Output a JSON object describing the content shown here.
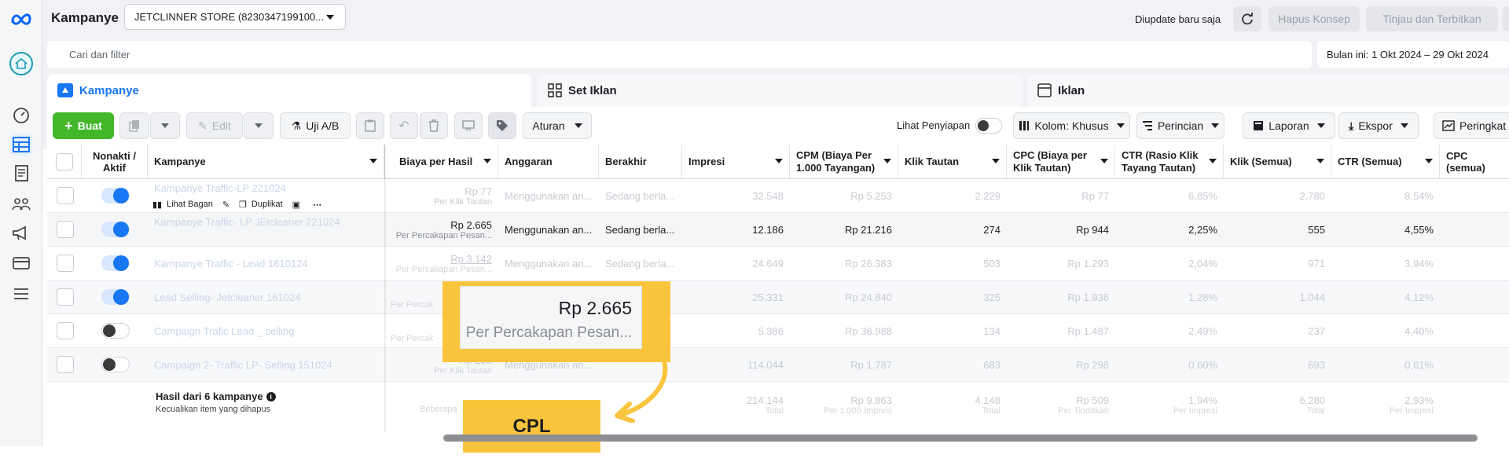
{
  "header": {
    "title": "Kampanye",
    "account_select": "JETCLINNER STORE (8230347199100...",
    "update_status": "Diupdate baru saja",
    "discard_label": "Hapus Konsep",
    "publish_label": "Tinjau dan Terbitkan",
    "more_label": "..."
  },
  "search": {
    "placeholder": "Cari dan filter",
    "date_range": "Bulan ini: 1 Okt 2024 – 29 Okt 2024"
  },
  "tabs": {
    "campaigns": "Kampanye",
    "adsets": "Set Iklan",
    "ads": "Iklan"
  },
  "toolbar": {
    "create": "Buat",
    "edit": "Edit",
    "ab_test": "Uji A/B",
    "rules": "Aturan",
    "preview_label": "Lihat Penyiapan",
    "columns": "Kolom: Khusus",
    "breakdown": "Perincian",
    "reports": "Laporan",
    "export": "Ekspor",
    "summary": "Peringkat"
  },
  "columns": {
    "toggle": "Nonakti / Aktif",
    "campaign": "Kampanye",
    "cost_per_result": "Biaya per Hasil",
    "budget": "Anggaran",
    "ends": "Berakhir",
    "impressions": "Impresi",
    "cpm": "CPM (Biaya Per 1.000 Tayangan)",
    "link_clicks": "Klik Tautan",
    "cpc_link": "CPC (Biaya per Klik Tautan)",
    "ctr_link": "CTR (Rasio Klik Tayang Tautan)",
    "clicks_all": "Klik (Semua)",
    "ctr_all": "CTR (Semua)",
    "cpc_all": "CPC (semua)"
  },
  "row_actions": {
    "view_chart": "Lihat Bagan",
    "duplicate": "Duplikat"
  },
  "rows": [
    {
      "name": "Kampanye Traffic-LP 221024",
      "active": true,
      "cpr": "Rp 77",
      "cpr_sub": "Per Klik Tautan",
      "budget": "Menggunakan an...",
      "ends": "Sedang berla...",
      "impressions": "32.548",
      "cpm": "Rp 5.253",
      "link_clicks": "2.229",
      "cpc": "Rp 77",
      "ctr_link": "6,85%",
      "clicks_all": "2.780",
      "ctr_all": "8,54%"
    },
    {
      "name": "Kampanye Traffic- LP JEtcleaner 221024",
      "active": true,
      "cpr": "Rp 2.665",
      "cpr_sub": "Per Percakapan Pesan...",
      "budget": "Menggunakan an...",
      "ends": "Sedang berla...",
      "impressions": "12.186",
      "cpm": "Rp 21.216",
      "link_clicks": "274",
      "cpc": "Rp 944",
      "ctr_link": "2,25%",
      "clicks_all": "555",
      "ctr_all": "4,55%"
    },
    {
      "name": "Kampanye Traffic - Lead 1610124",
      "active": true,
      "cpr": "Rp 3.142",
      "cpr_sub": "Per Percakapan Pesan...",
      "budget": "Menggunakan an...",
      "ends": "Sedang berla...",
      "impressions": "24.649",
      "cpm": "Rp 26.383",
      "link_clicks": "503",
      "cpc": "Rp 1.293",
      "ctr_link": "2,04%",
      "clicks_all": "971",
      "ctr_all": "3,94%"
    },
    {
      "name": "Lead Selling- Jetcleaner 161024",
      "active": true,
      "cpr": "",
      "cpr_sub": "Per Percak",
      "budget": "",
      "ends": "",
      "impressions": "25.331",
      "cpm": "Rp 24.840",
      "link_clicks": "325",
      "cpc": "Rp 1.936",
      "ctr_link": "1,28%",
      "clicks_all": "1.044",
      "ctr_all": "4,12%"
    },
    {
      "name": "Campaign Trafic Lead _ selling",
      "active": false,
      "cpr": "",
      "cpr_sub": "Per Percak",
      "budget": "",
      "ends": "",
      "impressions": "5.386",
      "cpm": "Rp 36.988",
      "link_clicks": "134",
      "cpc": "Rp 1.487",
      "ctr_link": "2,49%",
      "clicks_all": "237",
      "ctr_all": "4,40%"
    },
    {
      "name": "Campaign 2- Traffic LP- Selling 151024",
      "active": false,
      "cpr": "Rp 298",
      "cpr_sub": "Per Klik Tautan",
      "budget": "Menggunakan an...",
      "ends": "",
      "impressions": "114.044",
      "cpm": "Rp 1.787",
      "link_clicks": "683",
      "cpc": "Rp 298",
      "ctr_link": "0,60%",
      "clicks_all": "693",
      "ctr_all": "0,61%"
    }
  ],
  "summary": {
    "title": "Hasil dari 6 kampanye",
    "subtitle": "Kecualikan item yang dihapus",
    "cpr_sub": "Beberapa",
    "impressions": "214.144",
    "impressions_sub": "Total",
    "cpm": "Rp 9.863",
    "cpm_sub": "Per 1.000 Impresi",
    "link_clicks": "4.148",
    "link_clicks_sub": "Total",
    "cpc": "Rp 509",
    "cpc_sub": "Per Tindakan",
    "ctr_link": "1,94%",
    "ctr_link_sub": "Per Impresi",
    "clicks_all": "6.280",
    "clicks_all_sub": "Total",
    "ctr_all": "2,93%",
    "ctr_all_sub": "Per Impresi"
  },
  "callout": {
    "value": "Rp 2.665",
    "subtitle": "Per Percakapan Pesan...",
    "label": "CPL"
  },
  "colors": {
    "accent": "#1877f2",
    "create_button": "#42b72a",
    "highlight": "#fbc43d"
  }
}
